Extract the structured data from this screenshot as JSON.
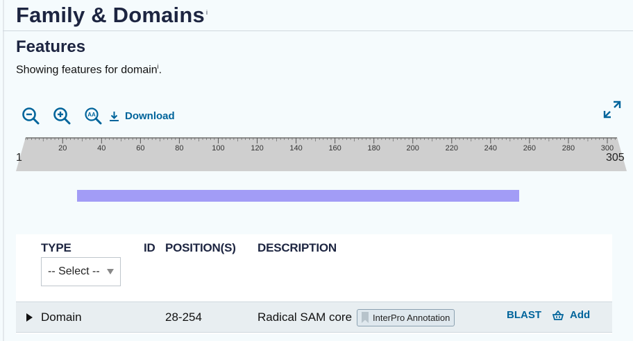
{
  "section": {
    "title": "Family & Domains",
    "info_marker": "i"
  },
  "features": {
    "title": "Features",
    "showing_text": "Showing features for domain",
    "info_marker": "i",
    "showing_suffix": "."
  },
  "toolbar": {
    "zoom_out_icon": "zoom-out-icon",
    "zoom_in_icon": "zoom-in-icon",
    "zoom_text_icon": "zoom-to-sequence-icon",
    "download_label": "Download",
    "expand_icon": "fullscreen-icon",
    "accent": "#00649b"
  },
  "ruler": {
    "start": "1",
    "end": "305",
    "sequence_length": 305,
    "ticks": [
      "20",
      "40",
      "60",
      "80",
      "100",
      "120",
      "140",
      "160",
      "180",
      "200",
      "220",
      "240",
      "260",
      "280",
      "300"
    ]
  },
  "domain_track": {
    "start": 28,
    "end": 254,
    "color": "#a29cf6"
  },
  "table": {
    "headers": {
      "type": "TYPE",
      "id": "ID",
      "positions": "POSITION(S)",
      "description": "DESCRIPTION"
    },
    "type_filter": {
      "selected": "-- Select --"
    },
    "rows": [
      {
        "type": "Domain",
        "id": "",
        "positions": "28-254",
        "description": "Radical SAM core",
        "badge": "InterPro Annotation",
        "blast_label": "BLAST",
        "add_label": "Add"
      }
    ]
  }
}
